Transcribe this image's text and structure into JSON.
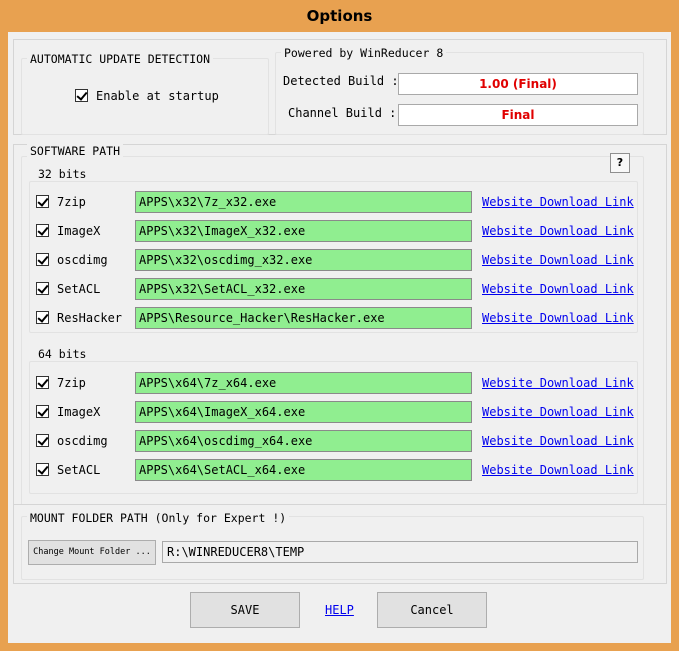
{
  "window": {
    "title": "Options"
  },
  "auto_update": {
    "group_title": "AUTOMATIC UPDATE DETECTION",
    "enable_label": "Enable at startup",
    "enable_checked": true
  },
  "powered": {
    "group_title": "Powered by WinReducer 8",
    "detected_label": "Detected Build :",
    "detected_value": "1.00 (Final)",
    "channel_label": "Channel Build :",
    "channel_value": "Final"
  },
  "software_path": {
    "group_title": "SOFTWARE PATH",
    "help_button": "?",
    "bits32": {
      "title": "32 bits",
      "items": [
        {
          "name": "7zip",
          "path": "APPS\\x32\\7z_x32.exe",
          "link": "Website Download Link",
          "checked": true
        },
        {
          "name": "ImageX",
          "path": "APPS\\x32\\ImageX_x32.exe",
          "link": "Website Download Link",
          "checked": true
        },
        {
          "name": "oscdimg",
          "path": "APPS\\x32\\oscdimg_x32.exe",
          "link": "Website Download Link",
          "checked": true
        },
        {
          "name": "SetACL",
          "path": "APPS\\x32\\SetACL_x32.exe",
          "link": "Website Download Link",
          "checked": true
        },
        {
          "name": "ResHacker",
          "path": "APPS\\Resource_Hacker\\ResHacker.exe",
          "link": "Website Download Link",
          "checked": true
        }
      ]
    },
    "bits64": {
      "title": "64 bits",
      "items": [
        {
          "name": "7zip",
          "path": "APPS\\x64\\7z_x64.exe",
          "link": "Website Download Link",
          "checked": true
        },
        {
          "name": "ImageX",
          "path": "APPS\\x64\\ImageX_x64.exe",
          "link": "Website Download Link",
          "checked": true
        },
        {
          "name": "oscdimg",
          "path": "APPS\\x64\\oscdimg_x64.exe",
          "link": "Website Download Link",
          "checked": true
        },
        {
          "name": "SetACL",
          "path": "APPS\\x64\\SetACL_x64.exe",
          "link": "Website Download Link",
          "checked": true
        }
      ]
    }
  },
  "mount": {
    "group_title": "MOUNT FOLDER PATH (Only for Expert !)",
    "change_button": "Change Mount Folder ...",
    "path": "R:\\WINREDUCER8\\TEMP"
  },
  "footer": {
    "save": "SAVE",
    "help": "HELP",
    "cancel": "Cancel"
  },
  "colors": {
    "title_bar": "#e8a150",
    "path_fill": "#90ee90",
    "build_text": "#e00000",
    "link": "#0000ee"
  }
}
